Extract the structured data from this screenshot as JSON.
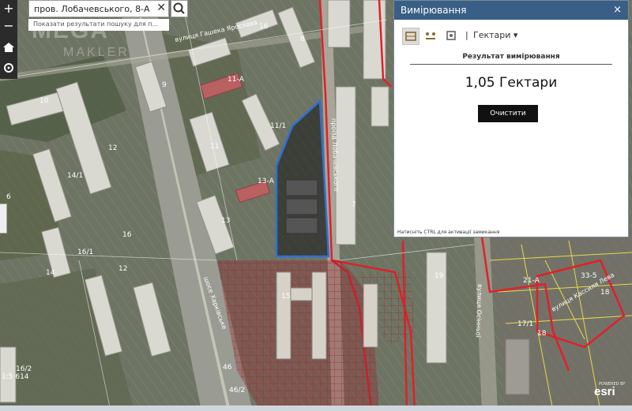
{
  "search": {
    "value": "пров. Лобачевського, 8-А",
    "hint": "Показати результати пошуку для п..."
  },
  "toolbar": {
    "zoom_in": "+",
    "zoom_out": "−"
  },
  "watermark": {
    "main": "MEGA",
    "sub": "MAKLER"
  },
  "map": {
    "scale": "1:5 614",
    "street_labels": [
      "вулиця Гашека Ярослава",
      "проїзд Лобачевського",
      "шосе Харківське",
      "вулиця Осінньої",
      "вулиця Кассиля Лева"
    ],
    "building_labels": [
      "16",
      "8",
      "10",
      "11-А",
      "11",
      "9",
      "12",
      "14/1",
      "13-А",
      "11/1",
      "13",
      "16",
      "16/1",
      "12",
      "7",
      "15",
      "19",
      "21-А",
      "33-5",
      "46",
      "46/2",
      "14",
      "18",
      "6",
      "16/2",
      "17/1",
      "18"
    ],
    "measured_area_color": "#2f6fd6",
    "parcel_color": "#e0202a"
  },
  "attribution": {
    "brand": "esri",
    "credit": "POWERED BY"
  },
  "panel": {
    "title": "Вимірювання",
    "close": "×",
    "unit_separator": "|",
    "unit": "Гектари",
    "result_label": "Результат вимірювання",
    "result_value": "1,05 Гектари",
    "clear_button": "Очистити",
    "hint": "Натисніть CTRL для активації замикання",
    "header_color": "#3a5f86"
  }
}
